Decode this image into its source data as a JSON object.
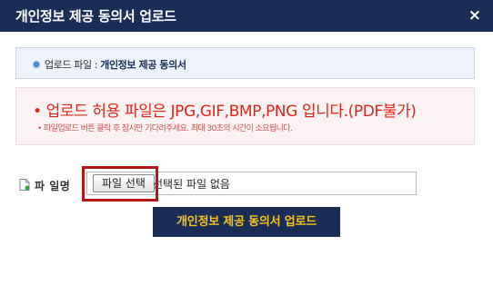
{
  "dialog": {
    "title": "개인정보 제공 동의서 업로드",
    "close_label": "×"
  },
  "info": {
    "prefix": "업로드 파일 :",
    "file_name": "개인정보 제공 동의서"
  },
  "notice": {
    "main": "• 업로드 허용 파일은 JPG,GIF,BMP,PNG 입니다.(PDF불가)",
    "sub": "• 파일업로드 버튼 클릭 후 잠시만 기다려주세요. 최대 30초의 시간이 소요됩니다."
  },
  "file_field": {
    "label": "파 일명",
    "button_label": "파일 선택",
    "status": "선택된 파일 없음"
  },
  "actions": {
    "upload_label": "개인정보 제공 동의서 업로드"
  },
  "colors": {
    "header_bg": "#1a2d57",
    "notice_red": "#e2241b",
    "button_text": "#f4c21a",
    "highlight": "#b81616"
  }
}
